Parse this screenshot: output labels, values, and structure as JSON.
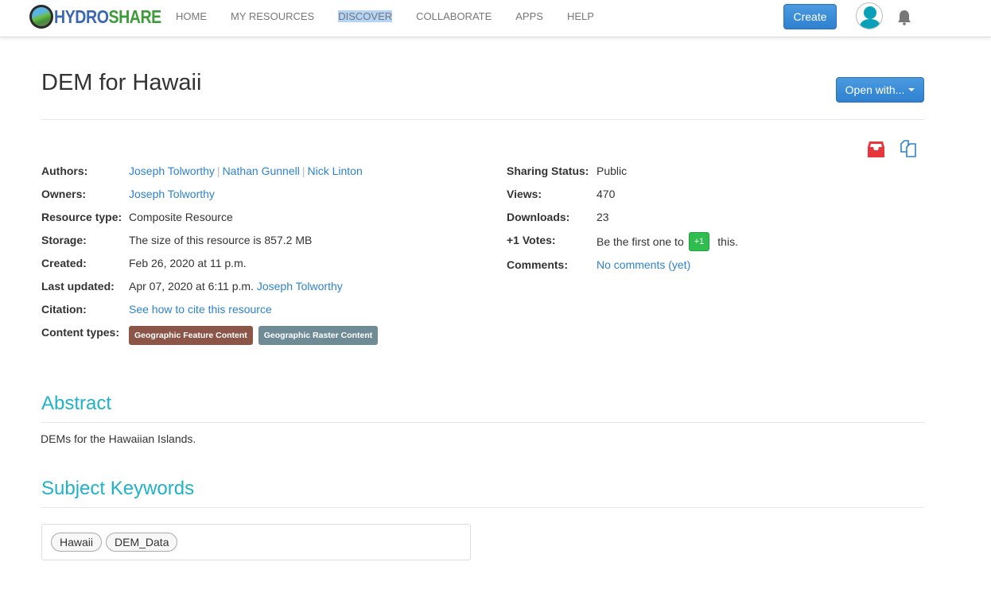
{
  "navbar": {
    "logo": {
      "part1": "HYDRO",
      "part2": "SHARE"
    },
    "links": [
      {
        "label": "HOME",
        "selected": false
      },
      {
        "label": "MY RESOURCES",
        "selected": false
      },
      {
        "label": "DISCOVER",
        "selected": true
      },
      {
        "label": "COLLABORATE",
        "selected": false
      },
      {
        "label": "APPS",
        "selected": false
      },
      {
        "label": "HELP",
        "selected": false
      }
    ],
    "create_label": "Create",
    "avatar_icon": "user-avatar-icon",
    "notifications_icon": "bell-icon"
  },
  "resource": {
    "title": "DEM for Hawaii",
    "open_with_label": "Open with...",
    "action_icons": [
      "inbox-icon",
      "copy-icon"
    ]
  },
  "meta_left": {
    "authors_label": "Authors:",
    "authors": [
      "Joseph Tolworthy",
      "Nathan Gunnell",
      "Nick Linton"
    ],
    "owners_label": "Owners:",
    "owners": [
      "Joseph Tolworthy"
    ],
    "resource_type_label": "Resource type:",
    "resource_type": "Composite Resource",
    "storage_label": "Storage:",
    "storage": "The size of this resource is 857.2 MB",
    "created_label": "Created:",
    "created": "Feb 26, 2020 at 11 p.m.",
    "last_updated_label": "Last updated:",
    "last_updated": "Apr 07, 2020 at 6:11 p.m.",
    "last_updated_by": "Joseph Tolworthy",
    "citation_label": "Citation:",
    "citation_link": "See how to cite this resource",
    "content_types_label": "Content types:",
    "content_types": [
      {
        "label": "Geographic Feature Content",
        "color": "#8b5547"
      },
      {
        "label": "Geographic Raster Content",
        "color": "#6e8b96"
      }
    ]
  },
  "meta_right": {
    "sharing_label": "Sharing Status:",
    "sharing": "Public",
    "views_label": "Views:",
    "views": "470",
    "downloads_label": "Downloads:",
    "downloads": "23",
    "votes_label": "+1 Votes:",
    "votes_prefix": "Be the first one to",
    "votes_button": "+1",
    "votes_suffix": "this.",
    "comments_label": "Comments:",
    "comments_link": "No comments (yet)"
  },
  "abstract": {
    "title": "Abstract",
    "text": "DEMs for the Hawaiian Islands."
  },
  "keywords": {
    "title": "Subject Keywords",
    "items": [
      "Hawaii",
      "DEM_Data"
    ]
  }
}
